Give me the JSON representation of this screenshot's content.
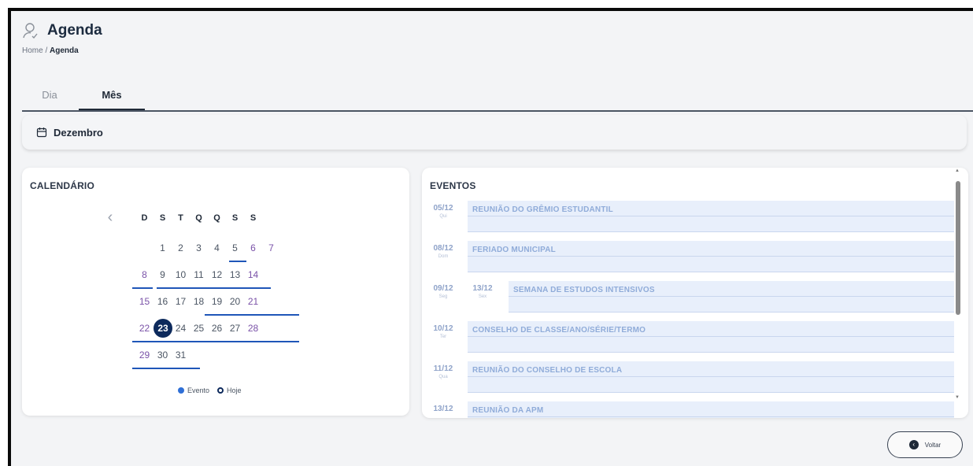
{
  "page": {
    "title": "Agenda"
  },
  "breadcrumb": {
    "home": "Home",
    "separator": " / ",
    "current": "Agenda"
  },
  "tabs": [
    {
      "label": "Dia",
      "active": false
    },
    {
      "label": "Mês",
      "active": true
    }
  ],
  "month": {
    "label": "Dezembro"
  },
  "calendar": {
    "title": "CALENDÁRIO",
    "weekdays": [
      "D",
      "S",
      "T",
      "Q",
      "Q",
      "S",
      "S"
    ],
    "today": 23,
    "weeks": [
      [
        "",
        "1",
        "2",
        "3",
        "4",
        "5",
        "6",
        "7"
      ],
      [
        "8",
        "9",
        "10",
        "11",
        "12",
        "13",
        "14"
      ],
      [
        "15",
        "16",
        "17",
        "18",
        "19",
        "20",
        "21"
      ],
      [
        "22",
        "23",
        "24",
        "25",
        "26",
        "27",
        "28"
      ],
      [
        "29",
        "30",
        "31"
      ]
    ],
    "legend": {
      "event": "Evento",
      "today": "Hoje"
    }
  },
  "events": {
    "title": "EVENTOS",
    "items": [
      {
        "start": "05/12",
        "start_weekday": "Qui",
        "end": "",
        "end_weekday": "",
        "name": "REUNIÃO DO GRÊMIO ESTUDANTIL"
      },
      {
        "start": "08/12",
        "start_weekday": "Dom",
        "end": "",
        "end_weekday": "",
        "name": "FERIADO MUNICIPAL"
      },
      {
        "start": "09/12",
        "start_weekday": "Seg",
        "end": "13/12",
        "end_weekday": "Sex",
        "name": "SEMANA DE ESTUDOS INTENSIVOS"
      },
      {
        "start": "10/12",
        "start_weekday": "Ter",
        "end": "",
        "end_weekday": "",
        "name": "CONSELHO DE CLASSE/ANO/SÉRIE/TERMO"
      },
      {
        "start": "11/12",
        "start_weekday": "Qua",
        "end": "",
        "end_weekday": "",
        "name": "REUNIÃO DO CONSELHO DE ESCOLA"
      },
      {
        "start": "13/12",
        "start_weekday": "",
        "end": "",
        "end_weekday": "",
        "name": "REUNIÃO DA APM"
      }
    ]
  },
  "actions": {
    "back_label": "Voltar"
  },
  "colors": {
    "accent": "#1f56b8",
    "today": "#0d2a5c",
    "event_bg": "#e8effb",
    "weekend": "#7a52a8"
  }
}
